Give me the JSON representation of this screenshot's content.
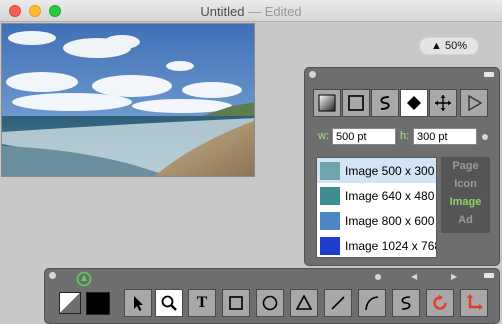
{
  "window": {
    "title": "Untitled",
    "status": "— Edited"
  },
  "zoom": {
    "label": "▲ 50%"
  },
  "inspector": {
    "tools": [
      {
        "name": "gradient-fill-tool",
        "icon": "gradient-icon"
      },
      {
        "name": "square-fill-tool",
        "icon": "square-icon"
      },
      {
        "name": "path-tool",
        "icon": "s-curve-icon"
      },
      {
        "name": "diamond-tool",
        "icon": "diamond-icon",
        "active": true
      },
      {
        "name": "move-tool",
        "icon": "move-arrows-icon"
      },
      {
        "name": "play-tool",
        "icon": "play-icon"
      }
    ],
    "width": {
      "label": "w:",
      "value": "500 pt"
    },
    "height": {
      "label": "h:",
      "value": "300 pt"
    },
    "presets": [
      {
        "label": "Image 500 x 300",
        "color": "#6fa6ad",
        "selected": true
      },
      {
        "label": "Image 640 x 480",
        "color": "#3d8c8f"
      },
      {
        "label": "Image 800 x 600",
        "color": "#4d86c0"
      },
      {
        "label": "Image 1024 x 768",
        "color": "#1e3ed0"
      }
    ],
    "categories": [
      {
        "label": "Page"
      },
      {
        "label": "Icon"
      },
      {
        "label": "Image",
        "active": true
      },
      {
        "label": "Ad"
      }
    ]
  },
  "toolbar": {
    "tools": [
      {
        "name": "select-tool",
        "icon": "arrow-pointer-icon"
      },
      {
        "name": "zoom-tool",
        "icon": "magnifier-icon",
        "active": true
      },
      {
        "name": "text-tool",
        "icon": "text-icon",
        "label": "T"
      },
      {
        "name": "rectangle-tool",
        "icon": "rectangle-icon"
      },
      {
        "name": "ellipse-tool",
        "icon": "circle-icon"
      },
      {
        "name": "triangle-tool",
        "icon": "triangle-icon"
      },
      {
        "name": "line-tool",
        "icon": "line-icon"
      },
      {
        "name": "arc-tool",
        "icon": "arc-icon"
      },
      {
        "name": "curve-tool",
        "icon": "s-curve-icon"
      },
      {
        "name": "rotate-tool",
        "icon": "rotate-icon"
      },
      {
        "name": "crop-tool",
        "icon": "crop-arrows-icon"
      }
    ],
    "colors": {
      "fill": "#ffffff",
      "stroke": "#000000",
      "swap_icon": "swap-color-icon"
    },
    "arrows": {
      "left": "◀",
      "right": "▶"
    }
  },
  "colors": {
    "panel": "#6e6e6e",
    "accent_green": "#8fd06a",
    "active_tool": "#ffffff"
  }
}
